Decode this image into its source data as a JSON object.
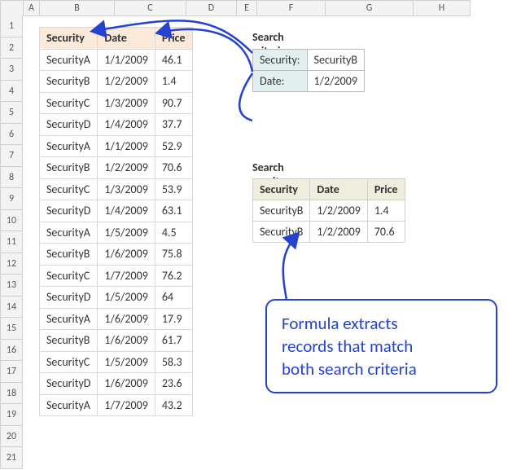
{
  "columns": [
    "",
    "A",
    "B",
    "C",
    "D",
    "E",
    "F",
    "G",
    "H"
  ],
  "row_numbers": [
    "1",
    "2",
    "3",
    "4",
    "5",
    "6",
    "7",
    "8",
    "9",
    "10",
    "11",
    "12",
    "13",
    "14",
    "15",
    "16",
    "17",
    "18",
    "19",
    "20",
    "21"
  ],
  "main_table": {
    "headers": {
      "security": "Security",
      "date": "Date",
      "price": "Price"
    },
    "rows": [
      {
        "security": "SecurityA",
        "date": "1/1/2009",
        "price": "46.1"
      },
      {
        "security": "SecurityB",
        "date": "1/2/2009",
        "price": "1.4"
      },
      {
        "security": "SecurityC",
        "date": "1/3/2009",
        "price": "90.7"
      },
      {
        "security": "SecurityD",
        "date": "1/4/2009",
        "price": "37.7"
      },
      {
        "security": "SecurityA",
        "date": "1/1/2009",
        "price": "52.9"
      },
      {
        "security": "SecurityB",
        "date": "1/2/2009",
        "price": "70.6"
      },
      {
        "security": "SecurityC",
        "date": "1/3/2009",
        "price": "53.9"
      },
      {
        "security": "SecurityD",
        "date": "1/4/2009",
        "price": "63.1"
      },
      {
        "security": "SecurityA",
        "date": "1/5/2009",
        "price": "4.5"
      },
      {
        "security": "SecurityB",
        "date": "1/6/2009",
        "price": "75.8"
      },
      {
        "security": "SecurityC",
        "date": "1/7/2009",
        "price": "76.2"
      },
      {
        "security": "SecurityD",
        "date": "1/5/2009",
        "price": "64"
      },
      {
        "security": "SecurityA",
        "date": "1/6/2009",
        "price": "17.9"
      },
      {
        "security": "SecurityB",
        "date": "1/6/2009",
        "price": "61.7"
      },
      {
        "security": "SecurityC",
        "date": "1/5/2009",
        "price": "58.3"
      },
      {
        "security": "SecurityD",
        "date": "1/6/2009",
        "price": "23.6"
      },
      {
        "security": "SecurityA",
        "date": "1/7/2009",
        "price": "43.2"
      }
    ]
  },
  "criteria": {
    "title": "Search criteria",
    "labels": {
      "security": "Security:",
      "date": "Date:"
    },
    "values": {
      "security": "SecurityB",
      "date": "1/2/2009"
    }
  },
  "results": {
    "title": "Search results",
    "headers": {
      "security": "Security",
      "date": "Date",
      "price": "Price"
    },
    "rows": [
      {
        "security": "SecurityB",
        "date": "1/2/2009",
        "price": "1.4"
      },
      {
        "security": "SecurityB",
        "date": "1/2/2009",
        "price": "70.6"
      }
    ]
  },
  "callout": {
    "line1": "Formula extracts",
    "line2": "records that match",
    "line3": "both search criteria"
  },
  "colors": {
    "arrow": "#2442cf"
  }
}
